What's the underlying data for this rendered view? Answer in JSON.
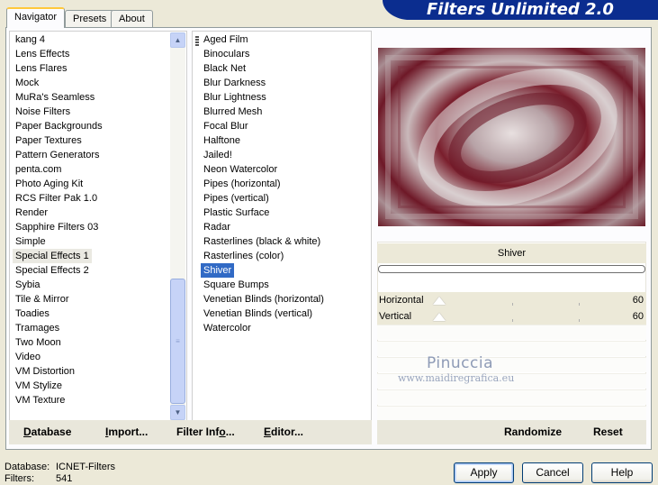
{
  "banner": {
    "title": "Filters Unlimited 2.0"
  },
  "tabs": [
    {
      "label": "Navigator",
      "active": true
    },
    {
      "label": "Presets",
      "active": false
    },
    {
      "label": "About",
      "active": false
    }
  ],
  "categories": {
    "items": [
      "kang 4",
      "Lens Effects",
      "Lens Flares",
      "Mock",
      "MuRa's Seamless",
      "Noise Filters",
      "Paper Backgrounds",
      "Paper Textures",
      "Pattern Generators",
      "penta.com",
      "Photo Aging Kit",
      "RCS Filter Pak 1.0",
      "Render",
      "Sapphire Filters 03",
      "Simple",
      "Special Effects 1",
      "Special Effects 2",
      "Sybia",
      "Tile & Mirror",
      "Toadies",
      "Tramages",
      "Two Moon",
      "Video",
      "VM Distortion",
      "VM Stylize",
      "VM Texture"
    ],
    "selected": "Special Effects 1"
  },
  "filters": {
    "items": [
      "Aged Film",
      "Binoculars",
      "Black Net",
      "Blur Darkness",
      "Blur Lightness",
      "Blurred Mesh",
      "Focal Blur",
      "Halftone",
      "Jailed!",
      "Neon Watercolor",
      "Pipes (horizontal)",
      "Pipes (vertical)",
      "Plastic Surface",
      "Radar",
      "Rasterlines (black & white)",
      "Rasterlines (color)",
      "Shiver",
      "Square Bumps",
      "Venetian Blinds (horizontal)",
      "Venetian Blinds (vertical)",
      "Watercolor"
    ],
    "selected": "Shiver"
  },
  "controls": {
    "filter_name": "Shiver",
    "sliders": [
      {
        "label": "Horizontal",
        "value": "60"
      },
      {
        "label": "Vertical",
        "value": "60"
      }
    ]
  },
  "watermark": {
    "line1": "Pinuccia",
    "line2": "www.maidiregrafica.eu"
  },
  "left_actions": {
    "database": "Database",
    "import": "Import...",
    "filter_info": "Filter Info...",
    "editor": "Editor..."
  },
  "right_actions": {
    "randomize": "Randomize",
    "reset": "Reset"
  },
  "footer": {
    "database_label": "Database:",
    "database_value": "ICNET-Filters",
    "filters_label": "Filters:",
    "filters_value": "541"
  },
  "buttons": {
    "apply": "Apply",
    "cancel": "Cancel",
    "help": "Help"
  },
  "colors": {
    "banner": "#0B2D8F",
    "selection": "#316AC5",
    "background": "#ECE9D8"
  }
}
